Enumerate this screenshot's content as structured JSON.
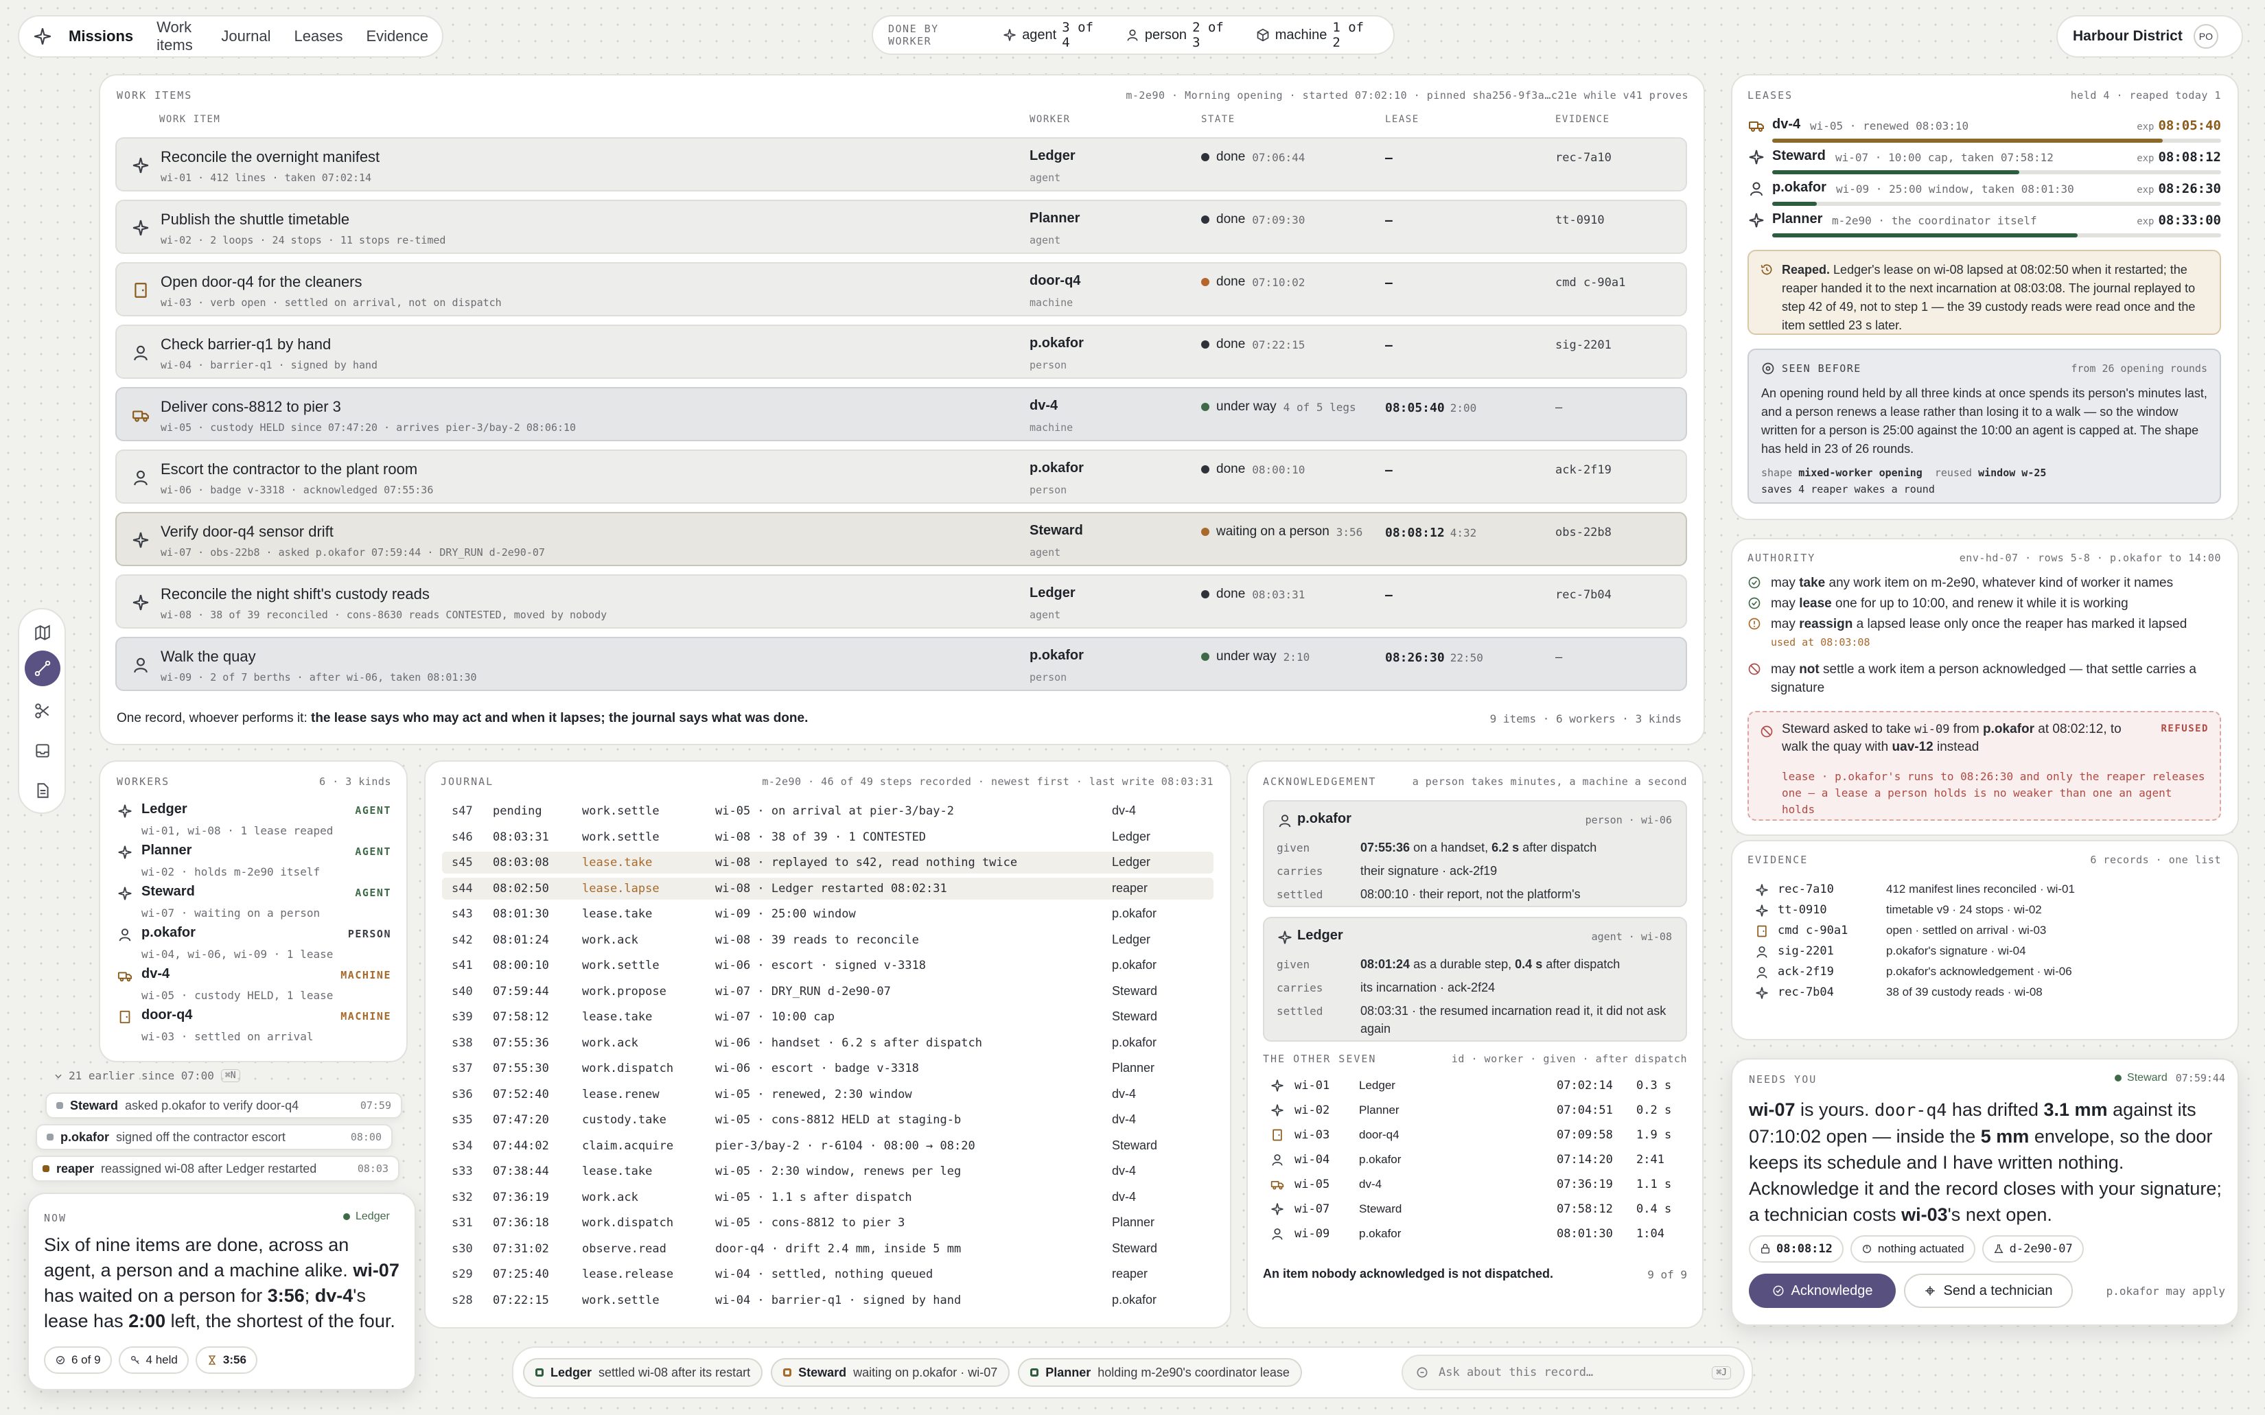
{
  "topbar": {
    "nav": [
      "Missions",
      "Work items",
      "Journal",
      "Leases",
      "Evidence"
    ],
    "done_label": "DONE BY WORKER",
    "done": [
      {
        "kind": "agent",
        "count": "3 of 4"
      },
      {
        "kind": "person",
        "count": "2 of 3"
      },
      {
        "kind": "machine",
        "count": "1 of 2"
      }
    ],
    "district": "Harbour District",
    "avatar": "PO"
  },
  "work": {
    "title": "WORK ITEMS",
    "meta": "m-2e90 · Morning opening · started 07:02:10 · pinned sha256-9f3a…c21e while v41 proves",
    "cols": [
      "WORK ITEM",
      "WORKER",
      "STATE",
      "LEASE",
      "EVIDENCE"
    ],
    "rows": [
      {
        "icon": "agent",
        "title": "Reconcile the overnight manifest",
        "sub": "wi-01 · 412 lines · taken 07:02:14",
        "worker": "Ledger",
        "kind": "agent",
        "state": "done",
        "time": "07:06:44",
        "lease": "—",
        "rem": "",
        "ev": "rec-7a10",
        "dot": "#2f3238"
      },
      {
        "icon": "agent",
        "title": "Publish the shuttle timetable",
        "sub": "wi-02 · 2 loops · 24 stops · 11 stops re-timed",
        "worker": "Planner",
        "kind": "agent",
        "state": "done",
        "time": "07:09:30",
        "lease": "—",
        "rem": "",
        "ev": "tt-0910",
        "dot": "#2f3238"
      },
      {
        "icon": "door",
        "title": "Open door-q4 for the cleaners",
        "sub": "wi-03 · verb open · settled on arrival, not on dispatch",
        "worker": "door-q4",
        "kind": "machine",
        "state": "done",
        "time": "07:10:02",
        "lease": "—",
        "rem": "",
        "ev": "cmd c-90a1",
        "dot": "#b5652a"
      },
      {
        "icon": "person",
        "title": "Check barrier-q1 by hand",
        "sub": "wi-04 · barrier-q1 · signed by hand",
        "worker": "p.okafor",
        "kind": "person",
        "state": "done",
        "time": "07:22:15",
        "lease": "—",
        "rem": "",
        "ev": "sig-2201",
        "dot": "#2f3238"
      },
      {
        "icon": "truck",
        "title": "Deliver cons-8812 to pier 3",
        "sub": "wi-05 · custody HELD since 07:47:20 · arrives pier-3/bay-2 08:06:10",
        "worker": "dv-4",
        "kind": "machine",
        "state": "under way",
        "time": "4 of 5 legs",
        "lease": "08:05:40",
        "rem": "2:00",
        "ev": "—",
        "dot": "#3f6a48"
      },
      {
        "icon": "person",
        "title": "Escort the contractor to the plant room",
        "sub": "wi-06 · badge v-3318 · acknowledged 07:55:36",
        "worker": "p.okafor",
        "kind": "person",
        "state": "done",
        "time": "08:00:10",
        "lease": "—",
        "rem": "",
        "ev": "ack-2f19",
        "dot": "#2f3238"
      },
      {
        "icon": "agent",
        "title": "Verify door-q4 sensor drift",
        "sub": "wi-07 · obs-22b8 · asked p.okafor 07:59:44 · DRY_RUN d-2e90-07",
        "worker": "Steward",
        "kind": "agent",
        "state": "waiting on a person",
        "time": "3:56",
        "lease": "08:08:12",
        "rem": "4:32",
        "ev": "obs-22b8",
        "dot": "#a8692b"
      },
      {
        "icon": "agent",
        "title": "Reconcile the night shift's custody reads",
        "sub": "wi-08 · 38 of 39 reconciled · cons-8630 reads CONTESTED, moved by nobody",
        "worker": "Ledger",
        "kind": "agent",
        "state": "done",
        "time": "08:03:31",
        "lease": "—",
        "rem": "",
        "ev": "rec-7b04",
        "dot": "#2f3238"
      },
      {
        "icon": "person",
        "title": "Walk the quay",
        "sub": "wi-09 · 2 of 7 berths · after wi-06, taken 08:01:30",
        "worker": "p.okafor",
        "kind": "person",
        "state": "under way",
        "time": "2:10",
        "lease": "08:26:30",
        "rem": "22:50",
        "ev": "—",
        "dot": "#3f6a48"
      }
    ],
    "footer_plain": "One record, whoever performs it:",
    "footer_bold": "the lease says who may act and when it lapses; the journal says what was done.",
    "footer_right": "9 items · 6 workers · 3 kinds"
  },
  "leases": {
    "title": "LEASES",
    "meta": "held 4 · reaped today 1",
    "rows": [
      {
        "icon": "truck",
        "name": "dv-4",
        "desc": "wi-05 · renewed 08:03:10",
        "exp": "08:05:40",
        "fill": 0.87,
        "color": "#8a6a2a",
        "expc": "#8a5a1a"
      },
      {
        "icon": "agent",
        "name": "Steward",
        "desc": "wi-07 · 10:00 cap, taken 07:58:12",
        "exp": "08:08:12",
        "fill": 0.55,
        "color": "#2e5c3e",
        "expc": "#1f2228"
      },
      {
        "icon": "person",
        "name": "p.okafor",
        "desc": "wi-09 · 25:00 window, taken 08:01:30",
        "exp": "08:26:30",
        "fill": 0.1,
        "color": "#2e5c3e",
        "expc": "#1f2228"
      },
      {
        "icon": "agent",
        "name": "Planner",
        "desc": "m-2e90 · the coordinator itself",
        "exp": "08:33:00",
        "fill": 0.68,
        "color": "#2e5c3e",
        "expc": "#1f2228"
      }
    ],
    "reaped_bold": "Reaped.",
    "reaped_text": "Ledger's lease on wi-08 lapsed at 08:02:50 when it restarted; the reaper handed it to the next incarnation at 08:03:08. The journal replayed to step 42 of 49, not to step 1 — the 39 custody reads were read once and the item settled 23 s later.",
    "seen": {
      "title": "SEEN BEFORE",
      "meta": "from 26 opening rounds",
      "text": "An opening round held by all three kinds at once spends its person's minutes last, and a person renews a lease rather than losing it to a walk — so the window written for a person is 25:00 against the 10:00 an agent is capped at. The shape has held in 23 of 26 rounds.",
      "l1k": "shape",
      "l1v": "mixed-worker opening",
      "l1k2": "reused",
      "l1v2": "window w-25",
      "l2": "saves 4 reaper wakes a round"
    }
  },
  "authority": {
    "title": "AUTHORITY",
    "meta": "env-hd-07 · rows 5-8 · p.okafor to 14:00",
    "rows": [
      {
        "icon": "ok",
        "pre": "may ",
        "b": "take",
        "post": " any work item on m-2e90, whatever kind of worker it names"
      },
      {
        "icon": "ok",
        "pre": "may ",
        "b": "lease",
        "post": " one for up to 10:00, and renew it while it is working"
      },
      {
        "icon": "warn",
        "pre": "may ",
        "b": "reassign",
        "post": " a lapsed lease only once the reaper has marked it lapsed",
        "sub": "used at 08:03:08"
      },
      {
        "icon": "no",
        "pre": "may ",
        "b": "not",
        "post": " settle a work item a person acknowledged — that settle carries a signature"
      }
    ],
    "refused": {
      "pre": "Steward asked to take ",
      "id": "wi-09",
      "mid": " from ",
      "who": "p.okafor",
      "post": " at 08:02:12, to walk the quay with ",
      "obj": "uav-12",
      "end": " instead",
      "badge": "REFUSED",
      "reason": "lease · p.okafor's runs to 08:26:30 and only the reaper releases one — a lease a person holds is no weaker than one an agent holds"
    }
  },
  "evidence": {
    "title": "EVIDENCE",
    "meta": "6 records · one list",
    "rows": [
      {
        "icon": "agent",
        "id": "rec-7a10",
        "desc": "412 manifest lines reconciled · wi-01"
      },
      {
        "icon": "agent",
        "id": "tt-0910",
        "desc": "timetable v9 · 24 stops · wi-02"
      },
      {
        "icon": "door",
        "id": "cmd c-90a1",
        "desc": "open · settled on arrival · wi-03"
      },
      {
        "icon": "person",
        "id": "sig-2201",
        "desc": "p.okafor's signature · wi-04"
      },
      {
        "icon": "person",
        "id": "ack-2f19",
        "desc": "p.okafor's acknowledgement · wi-06"
      },
      {
        "icon": "agent",
        "id": "rec-7b04",
        "desc": "38 of 39 custody reads · wi-08"
      }
    ]
  },
  "needs": {
    "title": "NEEDS YOU",
    "who": "Steward",
    "time": "07:59:44",
    "text": [
      [
        "b",
        "wi-07"
      ],
      [
        "t",
        " is yours. "
      ],
      [
        "m",
        "door-q4"
      ],
      [
        "t",
        " has drifted "
      ],
      [
        "b",
        "3.1 mm"
      ],
      [
        "t",
        " against its 07:10:02 open — inside the "
      ],
      [
        "b",
        "5 mm"
      ],
      [
        "t",
        " envelope, so the door keeps its schedule and I have written nothing. Acknowledge it and the record closes with your signature; a technician costs "
      ],
      [
        "b",
        "wi-03"
      ],
      [
        "t",
        "'s next open."
      ]
    ],
    "tags": [
      "08:08:12",
      "nothing actuated",
      "d-2e90-07"
    ],
    "ack": "Acknowledge",
    "tech": "Send a technician",
    "may": "p.okafor may apply"
  },
  "workers": {
    "title": "WORKERS",
    "meta": "6 · 3 kinds",
    "rows": [
      {
        "icon": "agent",
        "name": "Ledger",
        "desc": "wi-01, wi-08 · 1 lease reaped",
        "kind": "AGENT"
      },
      {
        "icon": "agent",
        "name": "Planner",
        "desc": "wi-02 · holds m-2e90 itself",
        "kind": "AGENT"
      },
      {
        "icon": "agent",
        "name": "Steward",
        "desc": "wi-07 · waiting on a person",
        "kind": "AGENT"
      },
      {
        "icon": "person",
        "name": "p.okafor",
        "desc": "wi-04, wi-06, wi-09 · 1 lease",
        "kind": "PERSON"
      },
      {
        "icon": "truck",
        "name": "dv-4",
        "desc": "wi-05 · custody HELD, 1 lease",
        "kind": "MACHINE"
      },
      {
        "icon": "door",
        "name": "door-q4",
        "desc": "wi-03 · settled on arrival",
        "kind": "MACHINE"
      }
    ]
  },
  "journal": {
    "title": "JOURNAL",
    "meta": "m-2e90 · 46 of 49 steps recorded · newest first · last write 08:03:31",
    "rows": [
      [
        "s47",
        "pending",
        "work.settle",
        "wi-05 · on arrival at pier-3/bay-2",
        "dv-4",
        0
      ],
      [
        "s46",
        "08:03:31",
        "work.settle",
        "wi-08 · 38 of 39 · 1 CONTESTED",
        "Ledger",
        0
      ],
      [
        "s45",
        "08:03:08",
        "lease.take",
        "wi-08 · replayed to s42, read nothing twice",
        "Ledger",
        1
      ],
      [
        "s44",
        "08:02:50",
        "lease.lapse",
        "wi-08 · Ledger restarted 08:02:31",
        "reaper",
        1
      ],
      [
        "s43",
        "08:01:30",
        "lease.take",
        "wi-09 · 25:00 window",
        "p.okafor",
        0
      ],
      [
        "s42",
        "08:01:24",
        "work.ack",
        "wi-08 · 39 reads to reconcile",
        "Ledger",
        0
      ],
      [
        "s41",
        "08:00:10",
        "work.settle",
        "wi-06 · escort · signed v-3318",
        "p.okafor",
        0
      ],
      [
        "s40",
        "07:59:44",
        "work.propose",
        "wi-07 · DRY_RUN d-2e90-07",
        "Steward",
        0
      ],
      [
        "s39",
        "07:58:12",
        "lease.take",
        "wi-07 · 10:00 cap",
        "Steward",
        0
      ],
      [
        "s38",
        "07:55:36",
        "work.ack",
        "wi-06 · handset · 6.2 s after dispatch",
        "p.okafor",
        0
      ],
      [
        "s37",
        "07:55:30",
        "work.dispatch",
        "wi-06 · escort · badge v-3318",
        "Planner",
        0
      ],
      [
        "s36",
        "07:52:40",
        "lease.renew",
        "wi-05 · renewed, 2:30 window",
        "dv-4",
        0
      ],
      [
        "s35",
        "07:47:20",
        "custody.take",
        "wi-05 · cons-8812 HELD at staging-b",
        "dv-4",
        0
      ],
      [
        "s34",
        "07:44:02",
        "claim.acquire",
        "pier-3/bay-2 · r-6104 · 08:00 → 08:20",
        "Steward",
        0
      ],
      [
        "s33",
        "07:38:44",
        "lease.take",
        "wi-05 · 2:30 window, renews per leg",
        "dv-4",
        0
      ],
      [
        "s32",
        "07:36:19",
        "work.ack",
        "wi-05 · 1.1 s after dispatch",
        "dv-4",
        0
      ],
      [
        "s31",
        "07:36:18",
        "work.dispatch",
        "wi-05 · cons-8812 to pier 3",
        "Planner",
        0
      ],
      [
        "s30",
        "07:31:02",
        "observe.read",
        "door-q4 · drift 2.4 mm, inside 5 mm",
        "Steward",
        0
      ],
      [
        "s29",
        "07:25:40",
        "lease.release",
        "wi-04 · settled, nothing queued",
        "reaper",
        0
      ],
      [
        "s28",
        "07:22:15",
        "work.settle",
        "wi-04 · barrier-q1 · signed by hand",
        "p.okafor",
        0
      ]
    ]
  },
  "ack": {
    "title": "ACKNOWLEDGEMENT",
    "meta": "a person takes minutes, a machine a second",
    "p": {
      "name": "p.okafor",
      "right": "person · wi-06",
      "given_b": "07:55:36",
      "given_m": " on a handset, ",
      "given_b2": "6.2 s",
      "given_t": " after dispatch",
      "carries": "their signature · ack-2f19",
      "settled": "08:00:10 · their report, not the platform's"
    },
    "l": {
      "name": "Ledger",
      "right": "agent · wi-08",
      "given_b": "08:01:24",
      "given_m": " as a durable step, ",
      "given_b2": "0.4 s",
      "given_t": " after dispatch",
      "carries": "its incarnation · ack-2f24",
      "settled": "08:03:31 · the resumed incarnation read it, it did not ask again"
    },
    "labels": [
      "given",
      "carries",
      "settled"
    ],
    "other_title": "THE OTHER SEVEN",
    "other_meta": "id · worker · given · after dispatch",
    "other": [
      {
        "icon": "agent",
        "id": "wi-01",
        "w": "Ledger",
        "g": "07:02:14",
        "a": "0.3 s"
      },
      {
        "icon": "agent",
        "id": "wi-02",
        "w": "Planner",
        "g": "07:04:51",
        "a": "0.2 s"
      },
      {
        "icon": "door",
        "id": "wi-03",
        "w": "door-q4",
        "g": "07:09:58",
        "a": "1.9 s"
      },
      {
        "icon": "person",
        "id": "wi-04",
        "w": "p.okafor",
        "g": "07:14:20",
        "a": "2:41"
      },
      {
        "icon": "truck",
        "id": "wi-05",
        "w": "dv-4",
        "g": "07:36:19",
        "a": "1.1 s"
      },
      {
        "icon": "agent",
        "id": "wi-07",
        "w": "Steward",
        "g": "07:58:12",
        "a": "0.4 s"
      },
      {
        "icon": "person",
        "id": "wi-09",
        "w": "p.okafor",
        "g": "08:01:30",
        "a": "1:04"
      }
    ],
    "footer": "An item nobody acknowledged is not dispatched.",
    "footer_right": "9 of 9"
  },
  "earlier": {
    "label": "21 earlier since 07:00",
    "key": "⌘N",
    "rows": [
      {
        "who": "Steward",
        "text": "asked p.okafor to verify door-q4",
        "time": "07:59",
        "color": "#9aa0a8"
      },
      {
        "who": "p.okafor",
        "text": "signed off the contractor escort",
        "time": "08:00",
        "color": "#9aa0a8"
      },
      {
        "who": "reaper",
        "text": "reassigned wi-08 after Ledger restarted",
        "time": "08:03",
        "color": "#8a5a1a"
      }
    ]
  },
  "now": {
    "title": "NOW",
    "who": "Ledger",
    "text": [
      [
        "t",
        "Six of nine items are done, across an agent, a person and a machine alike. "
      ],
      [
        "b",
        "wi-07"
      ],
      [
        "t",
        " has waited on a person for "
      ],
      [
        "b",
        "3:56"
      ],
      [
        "t",
        "; "
      ],
      [
        "b",
        "dv-4"
      ],
      [
        "t",
        "'s lease has "
      ],
      [
        "b",
        "2:00"
      ],
      [
        "t",
        " left, the shortest of the four."
      ]
    ],
    "tags": [
      "6 of 9",
      "4 held",
      "3:56"
    ]
  },
  "bottom": {
    "chips": [
      {
        "who": "Ledger",
        "text": "settled wi-08 after its restart",
        "color": "#2e5c3e"
      },
      {
        "who": "Steward",
        "text": "waiting on p.okafor · wi-07",
        "color": "#a8692b"
      },
      {
        "who": "Planner",
        "text": "holding m-2e90's coordinator lease",
        "color": "#2e5c3e"
      }
    ],
    "ask": "Ask about this record…",
    "key": "⌘J"
  },
  "sidebar": [
    "map-icon",
    "route-icon",
    "scissors-icon",
    "inbox-icon",
    "document-icon"
  ],
  "colors": {
    "green": "#3f6a48",
    "amber": "#a8692b",
    "ink": "#1f2228",
    "accent": "#58507f"
  }
}
